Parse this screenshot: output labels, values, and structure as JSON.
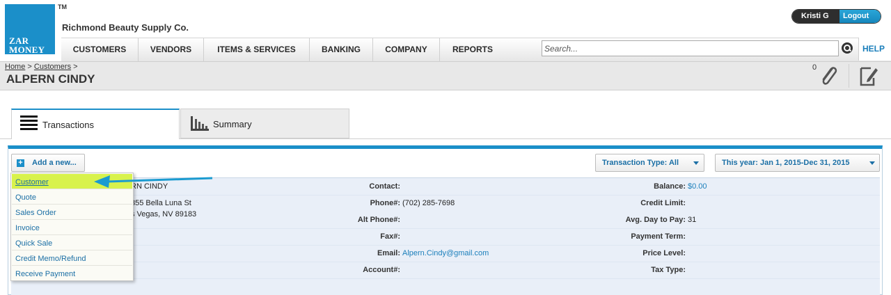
{
  "brand": {
    "logo_line1": "ZAR",
    "logo_line2": "MONEY",
    "trademark": "TM",
    "company": "Richmond Beauty Supply Co."
  },
  "user": {
    "name": "Kristi G",
    "logout": "Logout"
  },
  "nav": {
    "items": [
      "CUSTOMERS",
      "VENDORS",
      "ITEMS & SERVICES",
      "BANKING",
      "COMPANY",
      "REPORTS"
    ],
    "help": "HELP"
  },
  "search": {
    "placeholder": "Search..."
  },
  "breadcrumb": {
    "home": "Home",
    "sep": " > ",
    "customers": "Customers",
    "trail": " >"
  },
  "page": {
    "title": "ALPERN CINDY",
    "attachments": "0"
  },
  "tabs": [
    {
      "label": "Transactions"
    },
    {
      "label": "Summary"
    }
  ],
  "toolbar": {
    "add_new": "Add a new...",
    "transaction_type": "Transaction Type: All",
    "date_range": "This year: Jan 1, 2015-Dec 31, 2015"
  },
  "add_menu": [
    "Customer",
    "Quote",
    "Sales Order",
    "Invoice",
    "Quick Sale",
    "Credit Memo/Refund",
    "Receive Payment"
  ],
  "customer": {
    "name_partial": "RN CINDY",
    "address1_partial": "855 Bella Luna St",
    "address2_partial": "s Vegas, NV 89183",
    "contact_label": "Contact:",
    "contact": "",
    "phone_label": "Phone#:",
    "phone": "(702) 285-7698",
    "alt_phone_label": "Alt Phone#:",
    "alt_phone": "",
    "fax_label": "Fax#:",
    "fax": "",
    "email_label": "Email:",
    "email": "Alpern.Cindy@gmail.com",
    "account_label": "Account#:",
    "account": "",
    "balance_label": "Balance:",
    "balance": "$0.00",
    "credit_limit_label": "Credit Limit:",
    "credit_limit": "",
    "avg_day_label": "Avg. Day to Pay:",
    "avg_day": "31",
    "payment_term_label": "Payment Term:",
    "payment_term": "",
    "price_level_label": "Price Level:",
    "price_level": "",
    "tax_type_label": "Tax Type:",
    "tax_type": ""
  },
  "colors": {
    "accent": "#1b8fc9",
    "highlight": "#d8f24c",
    "link": "#1b7fbb",
    "panel_bg": "#e9eff8"
  }
}
